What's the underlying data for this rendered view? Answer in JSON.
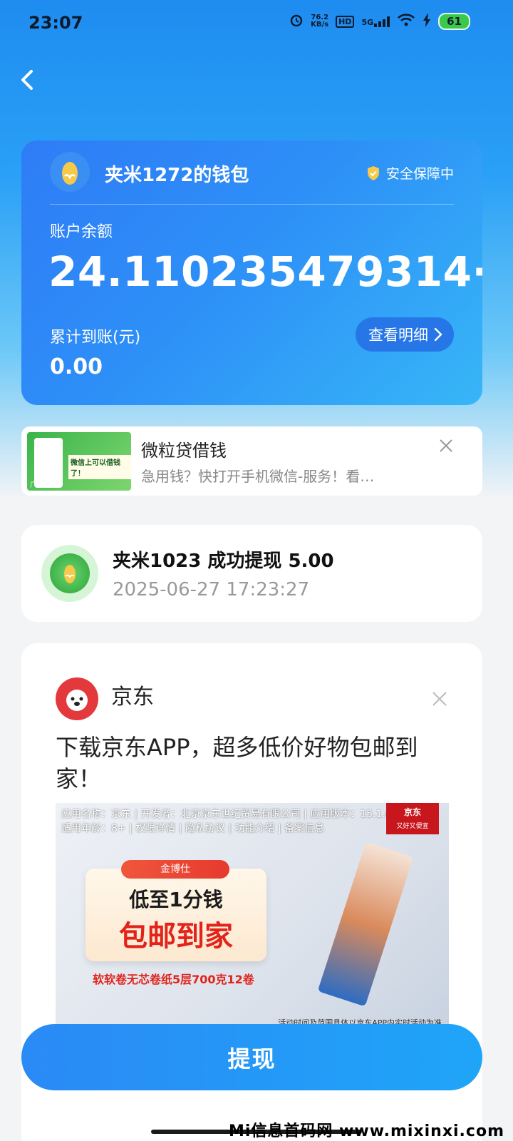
{
  "status_bar": {
    "time": "23:07",
    "net_speed_value": "76.2",
    "net_speed_unit": "KB/s",
    "hd_label": "HD",
    "network_type": "5G",
    "battery": "61"
  },
  "wallet": {
    "name": "夹米1272的钱包",
    "security_label": "安全保障中",
    "balance_label": "账户余额",
    "balance": "24.110235479314··",
    "total_label": "累计到账(元)",
    "total": "0.00",
    "detail_button": "查看明细"
  },
  "ad_weili": {
    "title": "微粒贷借钱",
    "description": "急用钱？快打开手机微信-服务！看…",
    "thumb_text": "微信上可以借钱了！",
    "ad_tag": "广告"
  },
  "record": {
    "title": "夹米1023 成功提现 5.00",
    "timestamp": "2025-06-27 17:23:27"
  },
  "ad_jd": {
    "brand": "京东",
    "headline": "下载京东APP，超多低价好物包邮到家！",
    "banner_meta_line1": "应用名称：京东 | 开发者：北京京东世纪贸易有限公司 | 应用版本：15.1.60 |",
    "banner_meta_line2": "适用年龄：8+ | 权限详情 | 隐私协议 | 功能介绍 | 备案信息",
    "banner_tag": "京东",
    "banner_tag_sub": "又好又便宜",
    "promo_pill": "金博仕",
    "promo_line1": "低至1分钱",
    "promo_line2": "包邮到家",
    "promo_sub": "软软卷无芯卷纸5层700克12卷",
    "banner_note": "活动时间及范围具体以京东APP内实时活动为准"
  },
  "withdraw_button": "提现",
  "watermark": "Mi信息首码网 www.mixinxi.com",
  "colors": {
    "primary_blue": "#2a8af6",
    "jd_red": "#e4393c"
  }
}
